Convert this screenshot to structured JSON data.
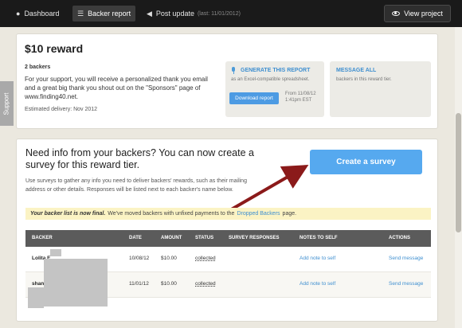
{
  "topbar": {
    "dashboard": {
      "label": "Dashboard",
      "icon": "info-icon"
    },
    "backer_report": {
      "label": "Backer report"
    },
    "post_update": {
      "label": "Post update",
      "sub": "(last: 11/01/2012)",
      "icon": "megaphone-icon"
    },
    "view_project": {
      "label": "View project",
      "icon": "eye-icon"
    }
  },
  "support_tab": "Support",
  "reward": {
    "title": "$10 reward",
    "backers": "2 backers",
    "description": "For your support, you will receive a personalized thank you email and a great big thank you shout out on the \"Sponsors\" page of www.finding40.net.",
    "delivery": "Estimated delivery: Nov 2012",
    "generate": {
      "title": "GENERATE THIS REPORT",
      "subtitle": "as an Excel-compatible spreadsheet.",
      "button": "Download report",
      "date_line1": "From 11/08/12",
      "date_line2": "1:41pm EST"
    },
    "message": {
      "title": "MESSAGE ALL",
      "subtitle": "backers in this reward tier."
    }
  },
  "survey": {
    "title": "Need info from your backers? You can now create a survey for this reward tier.",
    "description": "Use surveys to gather any info you need to deliver backers' rewards, such as their mailing address or other details. Responses will be listed next to each backer's name below.",
    "button": "Create a survey"
  },
  "notice": {
    "bold": "Your backer list is now final.",
    "text": "We've moved backers with unfixed payments to the",
    "link": "Dropped Backers",
    "end": "page."
  },
  "table": {
    "headers": [
      "BACKER",
      "DATE",
      "AMOUNT",
      "STATUS",
      "SURVEY RESPONSES",
      "NOTES TO SELF",
      "ACTIONS"
    ],
    "rows": [
      {
        "name": "Lolita F",
        "date": "10/08/12",
        "amount": "$10.00",
        "status": "collected",
        "note": "Add note to self",
        "action": "Send message"
      },
      {
        "name": "shanna",
        "date": "11/01/12",
        "amount": "$10.00",
        "status": "collected",
        "note": "Add note to self",
        "action": "Send message"
      }
    ]
  },
  "colors": {
    "topbar": "#1a1a1a",
    "accent_blue": "#56a9ef",
    "link_blue": "#3f8fd0",
    "notice_yellow": "#fbf3c4",
    "arrow": "#8b1a1a"
  }
}
